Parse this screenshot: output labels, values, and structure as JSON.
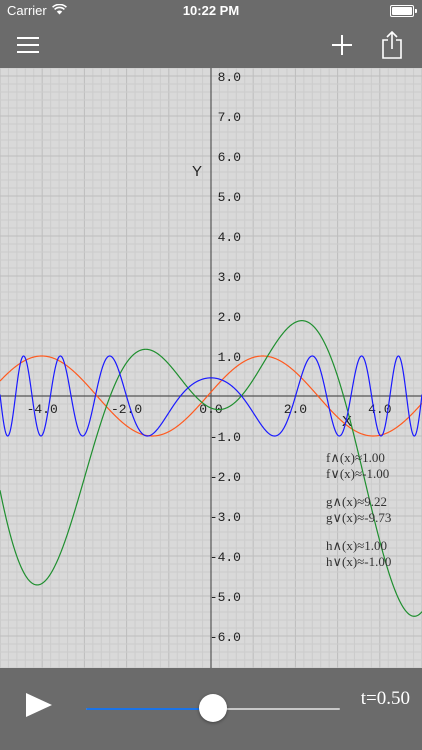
{
  "status_bar": {
    "carrier": "Carrier",
    "time": "10:22 PM"
  },
  "nav": {
    "menu_icon": "hamburger-menu-icon",
    "add_icon": "plus-icon",
    "share_icon": "share-icon"
  },
  "graph": {
    "axis_x_label": "X",
    "axis_y_label": "Y",
    "x_range": [
      -5.0,
      5.0
    ],
    "y_range": [
      -6.8,
      8.2
    ],
    "grid": true,
    "x_tick_labels": [
      "-4.0",
      "-2.0",
      "0.0",
      "2.0",
      "4.0"
    ],
    "y_tick_labels": [
      "8.0",
      "7.0",
      "6.0",
      "5.0",
      "4.0",
      "3.0",
      "2.0",
      "1.0",
      "-1.0",
      "-2.0",
      "-3.0",
      "-4.0",
      "-5.0",
      "-6.0"
    ],
    "colors": {
      "f": "#ff5a1f",
      "g": "#1f8f2f",
      "h": "#1a1aff"
    }
  },
  "legend": {
    "f_max": "f∧(x)≈1.00",
    "f_min": "f∨(x)≈-1.00",
    "g_max": "g∧(x)≈9.22",
    "g_min": "g∨(x)≈-9.73",
    "h_max": "h∧(x)≈1.00",
    "h_min": "h∨(x)≈-1.00"
  },
  "player": {
    "play_icon": "play-icon",
    "t_label": "t=0.50",
    "progress": 0.5
  }
}
